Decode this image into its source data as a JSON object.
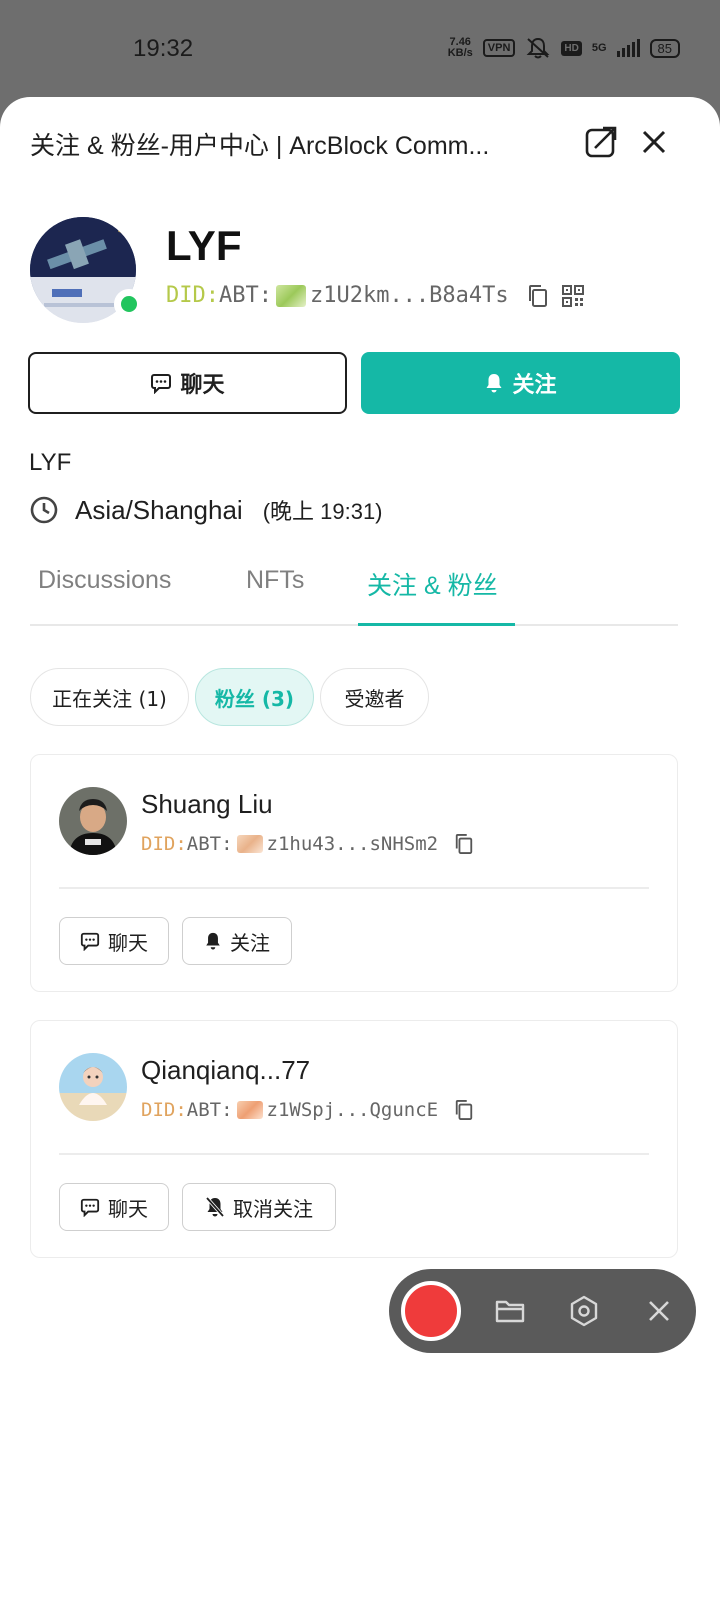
{
  "status_bar": {
    "time": "19:32",
    "speed_value": "7.46",
    "speed_unit": "KB/s",
    "vpn": "VPN",
    "hd": "HD",
    "network": "5G",
    "battery": "85"
  },
  "header": {
    "title": "关注 & 粉丝-用户中心 | ArcBlock Comm..."
  },
  "profile": {
    "name": "LYF",
    "did_prefix": "DID:",
    "did_abt": "ABT:",
    "did_value": "z1U2km...B8a4Ts",
    "chat_label": "聊天",
    "follow_label": "关注",
    "bio": "LYF",
    "timezone": "Asia/Shanghai",
    "local_time": "(晚上 19:31)"
  },
  "tabs": [
    {
      "label": "Discussions"
    },
    {
      "label": "NFTs"
    },
    {
      "label": "关注 & 粉丝"
    }
  ],
  "filters": [
    {
      "label": "正在关注 (1)"
    },
    {
      "label": "粉丝 (3)"
    },
    {
      "label": "受邀者"
    }
  ],
  "followers": [
    {
      "name": "Shuang Liu",
      "did_prefix": "DID:",
      "did_abt": "ABT:",
      "did_value": "z1hu43...sNHSm2",
      "chat_label": "聊天",
      "action_label": "关注"
    },
    {
      "name": "Qianqianq...77",
      "did_prefix": "DID:",
      "did_abt": "ABT:",
      "did_value": "z1WSpj...QguncE",
      "chat_label": "聊天",
      "action_label": "取消关注"
    }
  ],
  "colors": {
    "accent": "#15b8a6",
    "did_prefix": "#b5c94a",
    "record": "#ef3b3b",
    "online": "#22c55e"
  }
}
